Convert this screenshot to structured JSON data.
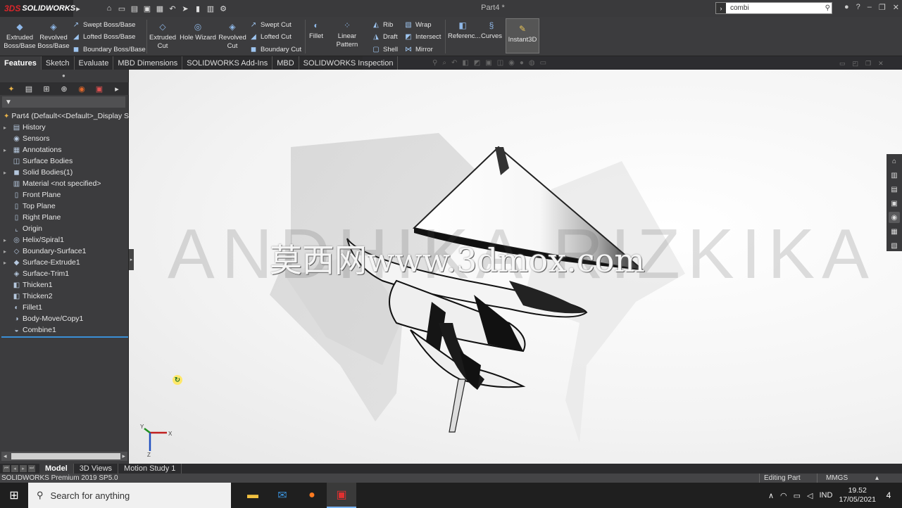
{
  "app": {
    "name": "SOLIDWORKS",
    "document_title": "Part4 *"
  },
  "search": {
    "value": "combi"
  },
  "ribbon": {
    "extruded_boss": "Extruded Boss/Base",
    "revolved_boss": "Revolved Boss/Base",
    "swept_boss": "Swept Boss/Base",
    "lofted_boss": "Lofted Boss/Base",
    "boundary_boss": "Boundary Boss/Base",
    "extruded_cut": "Extruded Cut",
    "hole_wizard": "Hole Wizard",
    "revolved_cut": "Revolved Cut",
    "swept_cut": "Swept Cut",
    "lofted_cut": "Lofted Cut",
    "boundary_cut": "Boundary Cut",
    "fillet": "Fillet",
    "linear_pattern": "Linear Pattern",
    "rib": "Rib",
    "draft": "Draft",
    "shell": "Shell",
    "wrap": "Wrap",
    "intersect": "Intersect",
    "mirror": "Mirror",
    "reference": "Referenc...",
    "curves": "Curves",
    "instant3d": "Instant3D"
  },
  "tabs": [
    "Features",
    "Sketch",
    "Evaluate",
    "MBD Dimensions",
    "SOLIDWORKS Add-Ins",
    "MBD",
    "SOLIDWORKS Inspection"
  ],
  "tree": {
    "root": "Part4  (Default<<Default>_Display S",
    "items": [
      {
        "label": "History",
        "icon": "history-icon",
        "expand": true
      },
      {
        "label": "Sensors",
        "icon": "sensor-icon",
        "expand": false
      },
      {
        "label": "Annotations",
        "icon": "annotation-icon",
        "expand": true
      },
      {
        "label": "Surface Bodies",
        "icon": "surface-bodies-icon",
        "expand": false
      },
      {
        "label": "Solid Bodies(1)",
        "icon": "solid-bodies-icon",
        "expand": true
      },
      {
        "label": "Material <not specified>",
        "icon": "material-icon",
        "expand": false
      },
      {
        "label": "Front Plane",
        "icon": "plane-icon",
        "expand": false
      },
      {
        "label": "Top Plane",
        "icon": "plane-icon",
        "expand": false
      },
      {
        "label": "Right Plane",
        "icon": "plane-icon",
        "expand": false
      },
      {
        "label": "Origin",
        "icon": "origin-icon",
        "expand": false
      },
      {
        "label": "Helix/Spiral1",
        "icon": "helix-icon",
        "expand": true
      },
      {
        "label": "Boundary-Surface1",
        "icon": "boundary-surface-icon",
        "expand": true
      },
      {
        "label": "Surface-Extrude1",
        "icon": "surface-extrude-icon",
        "expand": true
      },
      {
        "label": "Surface-Trim1",
        "icon": "surface-trim-icon",
        "expand": false
      },
      {
        "label": "Thicken1",
        "icon": "thicken-icon",
        "expand": false
      },
      {
        "label": "Thicken2",
        "icon": "thicken-icon",
        "expand": false
      },
      {
        "label": "Fillet1",
        "icon": "fillet-icon",
        "expand": false
      },
      {
        "label": "Body-Move/Copy1",
        "icon": "move-copy-icon",
        "expand": false
      },
      {
        "label": "Combine1",
        "icon": "combine-icon",
        "expand": false
      }
    ]
  },
  "viewport": {
    "watermark": "ANDHIKA RIZKIKA",
    "watermark2": "莫西网www.3dmox.com",
    "triad_x": "X",
    "triad_y": "Y",
    "triad_z": "Z"
  },
  "bottom_tabs": [
    "Model",
    "3D Views",
    "Motion Study 1"
  ],
  "status": {
    "product": "SOLIDWORKS Premium 2019 SP5.0",
    "mode": "Editing Part",
    "units": "MMGS"
  },
  "taskbar": {
    "search_placeholder": "Search for anything",
    "lang": "IND",
    "time": "19.52",
    "date": "17/05/2021",
    "notif_count": "4"
  },
  "colors": {
    "accent": "#3a8fd6",
    "brand": "#d9262b"
  }
}
